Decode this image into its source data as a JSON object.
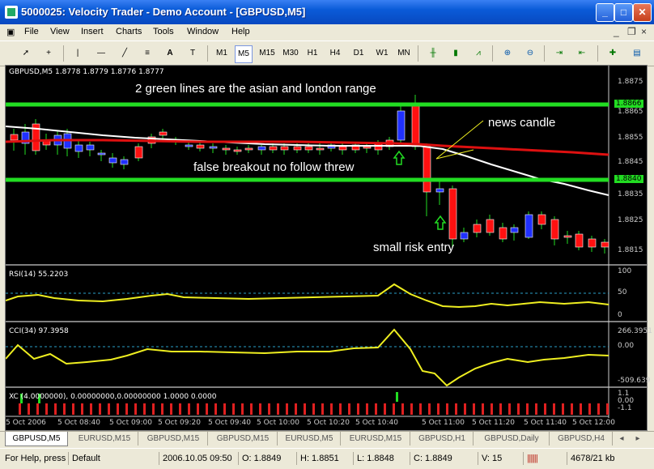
{
  "window": {
    "title": "5000025: Velocity Trader - Demo Account - [GBPUSD,M5]"
  },
  "menu": [
    "File",
    "View",
    "Insert",
    "Charts",
    "Tools",
    "Window",
    "Help"
  ],
  "toolbar": {
    "periods": [
      "M1",
      "M5",
      "M15",
      "M30",
      "H1",
      "H4",
      "D1",
      "W1",
      "MN"
    ],
    "selected_period": "M5",
    "text_tool": "A"
  },
  "chart": {
    "header": "GBPUSD,M5  1.8778 1.8779 1.8776 1.8777",
    "price_labels": [
      "1.8875",
      "1.8865",
      "1.8855",
      "1.8845",
      "1.8835",
      "1.8825",
      "1.8815"
    ],
    "green_labels": [
      "1.8866",
      "1.8840"
    ],
    "annotations": {
      "range": "2 green lines are the asian and london range",
      "news": "news candle",
      "false_breakout": "false breakout no follow threw",
      "small_risk": "small risk entry"
    },
    "rsi": {
      "label": "RSI(14) 55.2203",
      "levels": [
        "100",
        "50",
        "0"
      ]
    },
    "cci": {
      "label": "CCI(34) 97.3958",
      "levels": [
        "266.3951",
        "0.00",
        "-509.639"
      ]
    },
    "xc": {
      "label": "XC (4.0000000), 0.00000000,0.00000000 1.0000 0.0000",
      "levels": [
        "1.1",
        "0.00",
        "-1.1"
      ]
    },
    "time_labels": [
      "5 Oct 2006",
      "5 Oct 08:40",
      "5 Oct 09:00",
      "5 Oct 09:20",
      "5 Oct 09:40",
      "5 Oct 10:00",
      "5 Oct 10:20",
      "5 Oct 10:40",
      "5 Oct 11:00",
      "5 Oct 11:20",
      "5 Oct 11:40",
      "5 Oct 12:00"
    ]
  },
  "tabs": [
    "GBPUSD,M5",
    "EURUSD,M15",
    "GBPUSD,M15",
    "GBPUSD,M15",
    "EURUSD,M5",
    "EURUSD,M15",
    "GBPUSD,H1",
    "GBPUSD,Daily",
    "GBPUSD,H4"
  ],
  "status": {
    "help": "For Help, press",
    "profile": "Default",
    "time": "2006.10.05 09:50",
    "open": "O: 1.8849",
    "high": "H: 1.8851",
    "low": "L: 1.8848",
    "close": "C: 1.8849",
    "volume": "V: 15",
    "traffic": "4678/21 kb"
  },
  "colors": {
    "green_line": "#22dd22",
    "ma_red": "#dd1010",
    "ma_white": "#ffffff",
    "bull": "#2030ff",
    "bear": "#ff1010",
    "indicator": "#eeee20"
  }
}
